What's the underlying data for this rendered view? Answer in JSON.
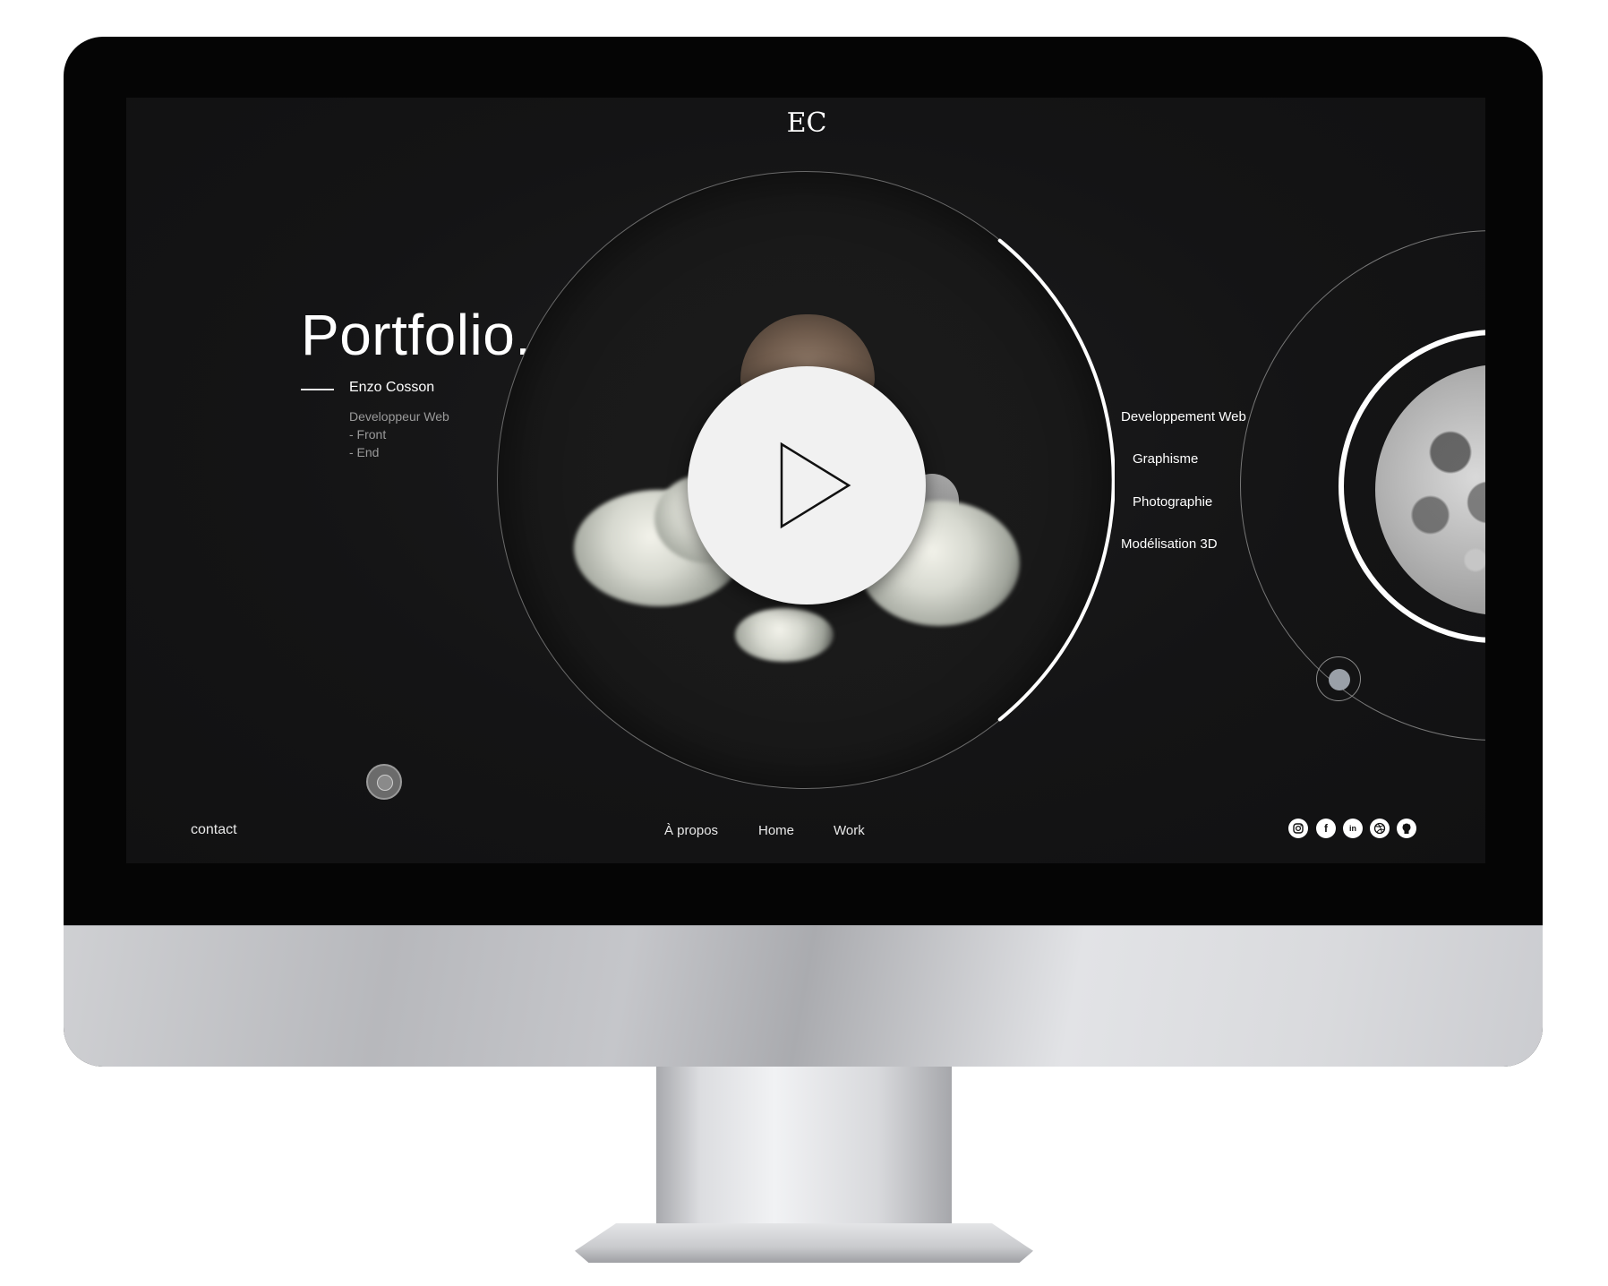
{
  "logo": {
    "text": "EC"
  },
  "hero": {
    "title": "Portfolio.",
    "name": "Enzo Cosson",
    "role_lines": [
      "Developpeur Web",
      "- Front",
      "- End"
    ]
  },
  "services": [
    {
      "label": "Developpement Web"
    },
    {
      "label": "Graphisme"
    },
    {
      "label": "Photographie"
    },
    {
      "label": "Modélisation 3D"
    }
  ],
  "footer": {
    "contact": "contact",
    "nav": [
      {
        "label": "À propos"
      },
      {
        "label": "Home"
      },
      {
        "label": "Work"
      }
    ],
    "social": [
      {
        "icon": "instagram-icon"
      },
      {
        "icon": "facebook-icon",
        "glyph": "f"
      },
      {
        "icon": "linkedin-icon",
        "glyph": "in"
      },
      {
        "icon": "dribbble-icon"
      },
      {
        "icon": "github-icon"
      }
    ]
  },
  "colors": {
    "background": "#141415",
    "accent": "#ffffff",
    "muted_text": "#9a9a9a",
    "play_button": "#f1f1f1"
  }
}
